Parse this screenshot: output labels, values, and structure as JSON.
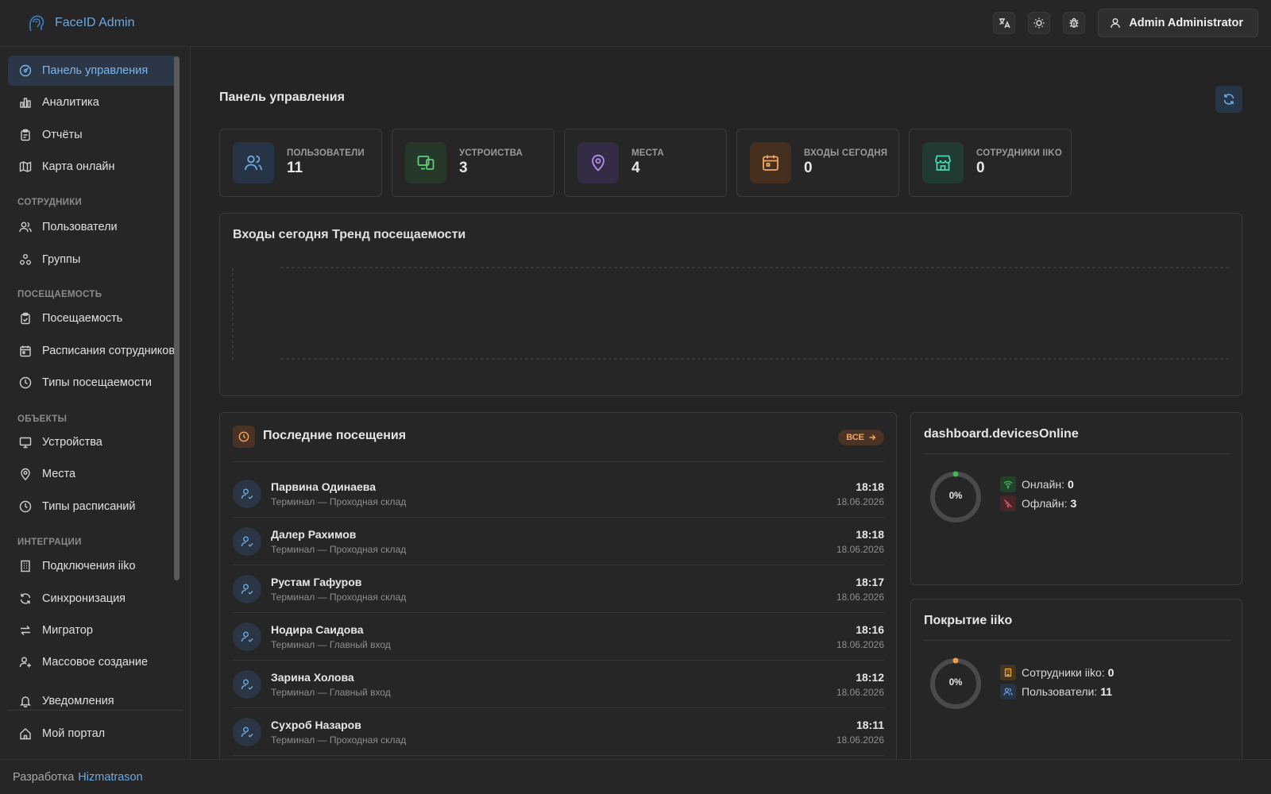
{
  "header": {
    "brand": "FaceID Admin",
    "user_label": "Admin Administrator",
    "icons": [
      "translate-icon",
      "sun-icon",
      "bug-icon",
      "user-icon"
    ]
  },
  "sidebar": {
    "items": [
      {
        "label": "Панель управления",
        "icon": "dashboard-icon"
      },
      {
        "label": "Аналитика",
        "icon": "bar-chart-icon"
      },
      {
        "label": "Отчёты",
        "icon": "clipboard-icon"
      },
      {
        "label": "Карта онлайн",
        "icon": "map-icon"
      },
      {
        "label": "Пользователи",
        "icon": "users-icon"
      },
      {
        "label": "Группы",
        "icon": "groups-icon"
      },
      {
        "label": "Посещаемость",
        "icon": "clipboard-check-icon"
      },
      {
        "label": "Расписания сотрудников",
        "icon": "calendar-icon"
      },
      {
        "label": "Типы посещаемости",
        "icon": "clock-icon"
      },
      {
        "label": "Устройства",
        "icon": "monitor-icon"
      },
      {
        "label": "Места",
        "icon": "map-pin-icon"
      },
      {
        "label": "Типы расписаний",
        "icon": "clock-icon"
      },
      {
        "label": "Подключения iiko",
        "icon": "building-icon"
      },
      {
        "label": "Синхронизация",
        "icon": "sync-icon"
      },
      {
        "label": "Мигратор",
        "icon": "arrows-icon"
      },
      {
        "label": "Массовое создание",
        "icon": "user-plus-icon"
      },
      {
        "label": "Уведомления",
        "icon": "bell-icon"
      }
    ],
    "sections": {
      "employees": "СОТРУДНИКИ",
      "attendance": "ПОСЕЩАЕМОСТЬ",
      "objects": "ОБЪЕКТЫ",
      "integrations": "ИНТЕГРАЦИИ"
    },
    "portal": "Мой портал"
  },
  "footer": {
    "prefix": "Разработка",
    "link": "Hizmatrason"
  },
  "main": {
    "title": "Панель управления",
    "stats": [
      {
        "label": "ПОЛЬЗОВАТЕЛИ",
        "value": "11",
        "icon": "users-icon",
        "color": "#6ea8e0"
      },
      {
        "label": "УСТРОЙСТВА",
        "value": "3",
        "icon": "devices-icon",
        "color": "#5fcf7a"
      },
      {
        "label": "МЕСТА",
        "value": "4",
        "icon": "map-pin-icon",
        "color": "#b48ef0"
      },
      {
        "label": "ВХОДЫ СЕГОДНЯ",
        "value": "0",
        "icon": "calendar-icon",
        "color": "#f0a560"
      },
      {
        "label": "СОТРУДНИКИ IIKO",
        "value": "0",
        "icon": "store-icon",
        "color": "#4fd6b0"
      }
    ],
    "trend_title": "Входы сегодня Тренд посещаемости",
    "recent": {
      "title": "Последние посещения",
      "all_label": "ВСЕ",
      "rows": [
        {
          "name": "Парвина Одинаева",
          "sub": "Терминал — Проходная склад",
          "time": "18:18",
          "date": "18.06.2026"
        },
        {
          "name": "Далер Рахимов",
          "sub": "Терминал — Проходная склад",
          "time": "18:18",
          "date": "18.06.2026"
        },
        {
          "name": "Рустам Гафуров",
          "sub": "Терминал — Проходная склад",
          "time": "18:17",
          "date": "18.06.2026"
        },
        {
          "name": "Нодира Саидова",
          "sub": "Терминал — Главный вход",
          "time": "18:16",
          "date": "18.06.2026"
        },
        {
          "name": "Зарина Холова",
          "sub": "Терминал — Главный вход",
          "time": "18:12",
          "date": "18.06.2026"
        },
        {
          "name": "Сухроб Назаров",
          "sub": "Терминал — Проходная склад",
          "time": "18:11",
          "date": "18.06.2026"
        }
      ]
    },
    "devices_online": {
      "title": "dashboard.devicesOnline",
      "percent": "0%",
      "percent_value": 0,
      "online_label": "Онлайн:",
      "online_value": "0",
      "offline_label": "Офлайн:",
      "offline_value": "3",
      "accent": "#3fb950"
    },
    "iiko_coverage": {
      "title": "Покрытие iiko",
      "percent": "0%",
      "percent_value": 0,
      "employees_label": "Сотрудники iiko:",
      "employees_value": "0",
      "users_label": "Пользователи:",
      "users_value": "11",
      "accent": "#f0a040"
    }
  },
  "chart_data": {
    "type": "line",
    "title": "Входы сегодня Тренд посещаемости",
    "categories": [],
    "series": [],
    "grid": true
  }
}
